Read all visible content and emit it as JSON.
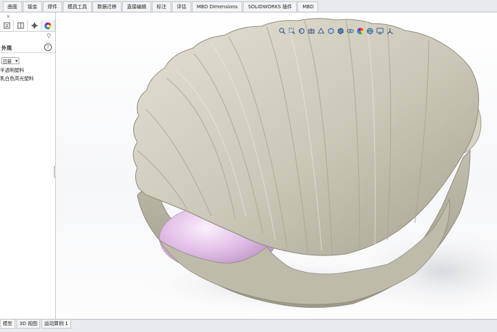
{
  "command_tabs": [
    "曲面",
    "钣金",
    "焊件",
    "模具工具",
    "数据迁移",
    "直接编辑",
    "标注",
    "评估",
    "MBD Dimensions",
    "SOLIDWORKS 插件",
    "MBD"
  ],
  "panel": {
    "close_glyph": "×",
    "appearance_title": "外观",
    "help_glyph": "?",
    "combo_value": "已新",
    "items": [
      "半透明塑料",
      "乳白色高光塑料"
    ],
    "manager_tab_icons": [
      "feature-manager-icon",
      "property-manager-icon",
      "configuration-manager-icon",
      "appearance-manager-icon"
    ]
  },
  "heads_up_toolbar_icons": [
    "zoom-to-fit-icon",
    "zoom-to-area-icon",
    "previous-view-icon",
    "section-view-icon",
    "dynamic-annotation-icon",
    "view-orientation-icon",
    "display-style-icon",
    "hide-show-icon",
    "edit-appearance-icon",
    "apply-scene-icon",
    "view-settings-icon",
    "triad-icon"
  ],
  "bottom_tabs": [
    "模型",
    "3D 视图",
    "运动算例 1"
  ],
  "model": {
    "description_icon": "3d-shell-model-icon",
    "shell_color": "#c9c5b6",
    "pearl_color": "#e6c8ea"
  }
}
